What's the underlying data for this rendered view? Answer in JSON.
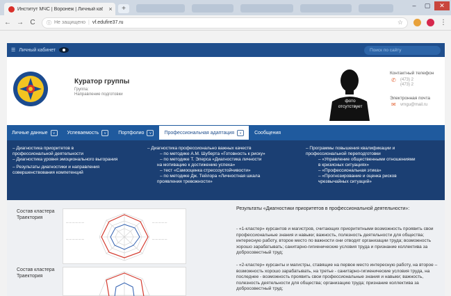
{
  "browser": {
    "tab_title": "Институт МЧС | Воронеж | Личный кабинет",
    "tab_close": "×",
    "new_tab": "+",
    "win_min": "–",
    "win_max": "▢",
    "win_close": "✕",
    "back": "←",
    "forward": "→",
    "reload": "C",
    "security_label": "Не защищено",
    "url": "vf.edufire37.ru",
    "bookmark": "☆",
    "colors": {
      "favicon": "#d9302a",
      "ext1": "#e8a13a",
      "ext2": "#d6294d"
    }
  },
  "site_header": {
    "account_label": "Личный кабинет",
    "search_placeholder": "Поиск по сайту"
  },
  "profile": {
    "title": "Куратор группы",
    "group_label": "Группа:",
    "direction_label": "Направление подготовки",
    "photo_caption_1": "фото",
    "photo_caption_2": "отсутствует",
    "phone_label": "Контактный телефон",
    "phone_1": "(473) 2",
    "phone_2": "(473) 2",
    "email_label": "Электронная почта",
    "email_value": "vrngu@mail.ru"
  },
  "nav": {
    "items": [
      {
        "label": "Личные данные",
        "chevron": "∨"
      },
      {
        "label": "Успеваемость",
        "chevron": "∨"
      },
      {
        "label": "Портфолио",
        "chevron": "∨"
      },
      {
        "label": "Профессиональная адаптация",
        "chevron": "∨"
      },
      {
        "label": "Сообщения"
      }
    ]
  },
  "dropdown": {
    "col1": [
      "– Диагностика приоритетов в",
      "профессиональной деятельности",
      "– Диагностика уровня эмоционального выгорания",
      "– Результаты диагностики и направления",
      "совершенствования компетенций"
    ],
    "col2": [
      "– Диагностика профессионально важных качеств",
      "– по методике А.М. Шуберта «Готовность к риску»",
      "– по методике Т. Элерса «Диагностика личности",
      "на мотивацию к достижению успеха»",
      "– тест «Самооценка стрессоустойчивости»",
      "– по методике Дж. Тейлора «Личностная шкала",
      "проявления тревожности»"
    ],
    "col3": [
      "– Программы повышения квалификации и",
      "профессиональной переподготовки",
      "– «Управление общественными отношениями",
      "в кризисных ситуациях»",
      "– «Профессиональная этика»",
      "– «Прогнозирование и оценка рисков",
      "чрезвычайных ситуаций»"
    ]
  },
  "content": {
    "cluster_1": [
      "Состав кластера",
      "Траектория"
    ],
    "cluster_2": [
      "Состав кластера",
      "Траектория"
    ],
    "results_title": "Результаты «Диагностики приоритетов в профессиональной деятельности»:",
    "para_1": "- «1-кластер» курсантов и магистров, считающих приоритетными возможность проявить свои профессиональные знания и навыки; важность, полезность деятельности для общества; интересную работу, второе место по важности они отводят организации труда; возможность хорошо зарабатывать; санитарно-гигиенические условия труда и признание коллектива за добросовестный труд;",
    "para_2": "- «2-кластер» курсанты и магистры, ставящие на первое место интересную работу, на второе – возможность хорошо зарабатывать, на третье - санитарно-гигиенические условия труда, на последнее - возможность проявить свои профессиональные знания и навыки; важность, полезность деятельности для общества; организацию труда; признание коллектива за добросовестный труд;",
    "colors": {
      "radar_red": "#d43b2f",
      "radar_blue": "#2f5fb0"
    }
  }
}
